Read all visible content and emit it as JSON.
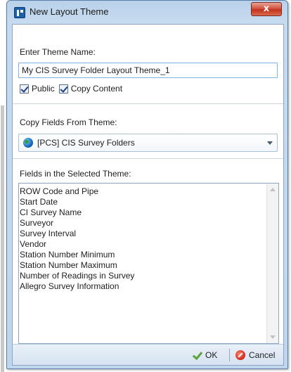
{
  "window": {
    "title": "New Layout Theme",
    "close_label": "x"
  },
  "theme_name": {
    "label": "Enter Theme Name:",
    "value": "My CIS Survey Folder Layout Theme_1"
  },
  "options": {
    "public_label": "Public",
    "public_checked": true,
    "copy_content_label": "Copy Content",
    "copy_content_checked": true
  },
  "copy_fields": {
    "label": "Copy Fields From Theme:",
    "selected": "[PCS] CIS Survey Folders",
    "icon": "globe-icon"
  },
  "fields": {
    "label": "Fields in the Selected Theme:",
    "items": [
      "ROW Code and Pipe",
      "Start Date",
      "CI Survey Name",
      "Surveyor",
      "Survey Interval",
      "Vendor",
      "Station Number Minimum",
      "Station Number Maximum",
      "Number of Readings in Survey",
      "Allegro Survey Information"
    ]
  },
  "footer": {
    "ok_label": "OK",
    "ok_icon": "checkmark-icon",
    "cancel_label": "Cancel",
    "cancel_icon": "cancel-icon",
    "ok_icon_color": "#5aa23a",
    "cancel_icon_color": "#d8321f"
  }
}
